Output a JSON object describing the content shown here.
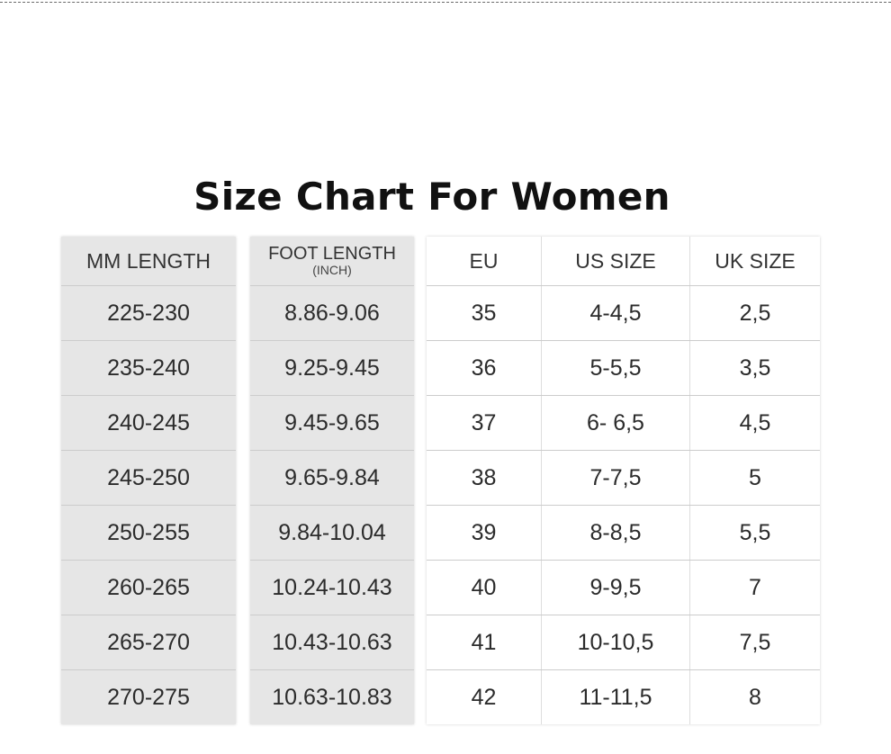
{
  "title": "Size Chart For Women",
  "headers": {
    "mm_length": "MM LENGTH",
    "foot_length": "FOOT LENGTH",
    "foot_length_unit": "(INCH)",
    "eu": "EU",
    "us_size": "US SIZE",
    "uk_size": "UK SIZE"
  },
  "rows": [
    {
      "mm": "225-230",
      "foot": "8.86-9.06",
      "eu": "35",
      "us": "4-4,5",
      "uk": "2,5"
    },
    {
      "mm": "235-240",
      "foot": "9.25-9.45",
      "eu": "36",
      "us": "5-5,5",
      "uk": "3,5"
    },
    {
      "mm": "240-245",
      "foot": "9.45-9.65",
      "eu": "37",
      "us": "6- 6,5",
      "uk": "4,5"
    },
    {
      "mm": "245-250",
      "foot": "9.65-9.84",
      "eu": "38",
      "us": "7-7,5",
      "uk": "5"
    },
    {
      "mm": "250-255",
      "foot": "9.84-10.04",
      "eu": "39",
      "us": "8-8,5",
      "uk": "5,5"
    },
    {
      "mm": "260-265",
      "foot": "10.24-10.43",
      "eu": "40",
      "us": "9-9,5",
      "uk": "7"
    },
    {
      "mm": "265-270",
      "foot": "10.43-10.63",
      "eu": "41",
      "us": "10-10,5",
      "uk": "7,5"
    },
    {
      "mm": "270-275",
      "foot": "10.63-10.83",
      "eu": "42",
      "us": "11-11,5",
      "uk": "8"
    }
  ]
}
